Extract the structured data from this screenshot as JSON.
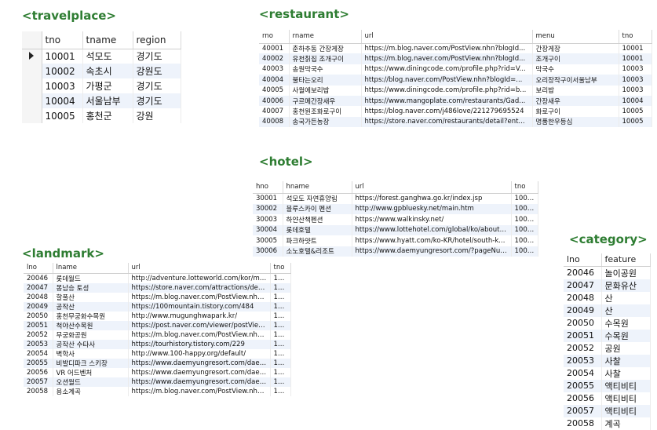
{
  "travelplace": {
    "title": "<travelplace>",
    "columns": [
      "tno",
      "tname",
      "region"
    ],
    "rows": [
      [
        "10001",
        "석모도",
        "경기도"
      ],
      [
        "10002",
        "속초시",
        "강원도"
      ],
      [
        "10003",
        "가평군",
        "경기도"
      ],
      [
        "10004",
        "서울남부",
        "경기도"
      ],
      [
        "10005",
        "홍천군",
        "강원"
      ]
    ]
  },
  "restaurant": {
    "title": "<restaurant>",
    "columns": [
      "rno",
      "rname",
      "url",
      "menu",
      "tno"
    ],
    "rows": [
      [
        "40001",
        "춘하추동 간장게장",
        "https://m.blog.naver.com/PostView.nhn?blogId...",
        "간장게장",
        "10001"
      ],
      [
        "40002",
        "유천칡집 조개구이",
        "https://m.blog.naver.com/PostView.nhn?blogId...",
        "조개구이",
        "10001"
      ],
      [
        "40003",
        "송원막국수",
        "https://www.diningcode.com/profile.php?rid=V...",
        "막국수",
        "10003"
      ],
      [
        "40004",
        "불타는오리",
        "https://blog.naver.com/PostView.nhn?blogId=...",
        "오리장작구이서울남부",
        "10003"
      ],
      [
        "40005",
        "사월에보리밥",
        "https://www.diningcode.com/profile.php?rid=b...",
        "보리밥",
        "10003"
      ],
      [
        "40006",
        "구르메간장새우",
        "https://www.mangoplate.com/restaurants/Gad...",
        "간장새우",
        "10004"
      ],
      [
        "40007",
        "홍천원조화로구이",
        "https://blog.naver.com/j486love/221279695524",
        "화로구이",
        "10005"
      ],
      [
        "40008",
        "송국가든농장",
        "https://store.naver.com/restaurants/detail?ent...",
        "명품한우등심",
        "10005"
      ]
    ]
  },
  "hotel": {
    "title": "<hotel>",
    "columns": [
      "hno",
      "hname",
      "url",
      "tno"
    ],
    "rows": [
      [
        "30001",
        "석모도 자연휴양림",
        "https://forest.ganghwa.go.kr/index.jsp",
        "10001"
      ],
      [
        "30002",
        "블루스카이 펜션",
        "http://www.gpbluesky.net/main.htm",
        "10003"
      ],
      [
        "30003",
        "하얀산책펜션",
        "https://www.walkinsky.net/",
        "10003"
      ],
      [
        "30004",
        "롯데호텔",
        "https://www.lottehotel.com/global/ko/about/lot...",
        "10004"
      ],
      [
        "30005",
        "파크하얏트",
        "https://www.hyatt.com/ko-KR/hotel/south-kore...",
        "10004"
      ],
      [
        "30006",
        "소노호텔&리조트",
        "https://www.daemyungresort.com/?pageNum=0",
        "10005"
      ]
    ]
  },
  "landmark": {
    "title": "<landmark>",
    "columns": [
      "lno",
      "lname",
      "url",
      "tno"
    ],
    "rows": [
      [
        "20046",
        "롯데월드",
        "http://adventure.lotteworld.com/kor/main/inde...",
        "10004"
      ],
      [
        "20047",
        "몽남승 토성",
        "https://store.naver.com/attractions/detail?entr...",
        "10004"
      ],
      [
        "20048",
        "할풀산",
        "https://m.blog.naver.com/PostView.nhn?blogId...",
        "10005"
      ],
      [
        "20049",
        "공작산",
        "https://100mountain.tistory.com/484",
        "10005"
      ],
      [
        "20050",
        "홍천무궁화수목원",
        "http://www.mugunghwapark.kr/",
        "10005"
      ],
      [
        "20051",
        "척야산수목원",
        "https://post.naver.com/viewer/postView.nhn?v...",
        "10005"
      ],
      [
        "20052",
        "무궁화공원",
        "https://m.blog.naver.com/PostView.nhn?blogId...",
        "10005"
      ],
      [
        "20053",
        "공작산 수타사",
        "https://tourhistory.tistory.com/229",
        "10005"
      ],
      [
        "20054",
        "벽학사",
        "http://www.100-happy.org/default/",
        "10005"
      ],
      [
        "20055",
        "비발디파크 스키장",
        "https://www.daemyungresort.com/daemyung....",
        "10005"
      ],
      [
        "20056",
        "VR 어드벤처",
        "https://www.daemyungresort.com/daemyung....",
        "10005"
      ],
      [
        "20057",
        "오션월드",
        "https://www.daemyungresort.com/daemyung....",
        "10005"
      ],
      [
        "20058",
        "용소계곡",
        "https://m.blog.naver.com/PostView.nhn?blogId...",
        "10005"
      ]
    ]
  },
  "category": {
    "title": "<category>",
    "columns": [
      "lno",
      "feature"
    ],
    "rows": [
      [
        "20046",
        "놀이공원"
      ],
      [
        "20047",
        "문화유산"
      ],
      [
        "20048",
        "산"
      ],
      [
        "20049",
        "산"
      ],
      [
        "20050",
        "수목원"
      ],
      [
        "20051",
        "수목원"
      ],
      [
        "20052",
        "공원"
      ],
      [
        "20053",
        "사찰"
      ],
      [
        "20054",
        "사찰"
      ],
      [
        "20055",
        "액티비티"
      ],
      [
        "20056",
        "액티비티"
      ],
      [
        "20057",
        "액티비티"
      ],
      [
        "20058",
        "계곡"
      ]
    ]
  }
}
